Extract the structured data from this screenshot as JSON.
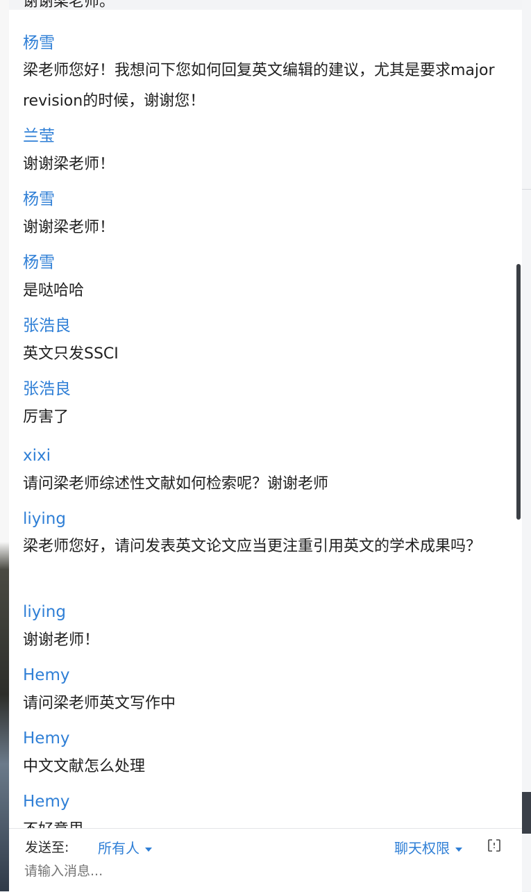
{
  "messages": [
    {
      "sender": "",
      "text": "谢谢梁老师。"
    },
    {
      "sender": "杨雪",
      "text": "梁老师您好！我想问下您如何回复英文编辑的建议，尤其是要求major revision的时候，谢谢您！"
    },
    {
      "sender": "兰莹",
      "text": "谢谢梁老师！"
    },
    {
      "sender": "杨雪",
      "text": "谢谢梁老师！"
    },
    {
      "sender": "杨雪",
      "text": "是哒哈哈"
    },
    {
      "sender": "张浩良",
      "text": "英文只发SSCI"
    },
    {
      "sender": "张浩良",
      "text": "厉害了"
    },
    {
      "sender": "xixi",
      "text": "请问梁老师综述性文献如何检索呢？谢谢老师"
    },
    {
      "sender": "liying",
      "text": "梁老师您好，请问发表英文论文应当更注重引用英文的学术成果吗？"
    },
    {
      "sender": "liying",
      "text": "谢谢老师！"
    },
    {
      "sender": "Hemy",
      "text": "请问梁老师英文写作中"
    },
    {
      "sender": "Hemy",
      "text": "中文文献怎么处理"
    },
    {
      "sender": "Hemy",
      "text": "不好意思"
    }
  ],
  "footer": {
    "send_to_label": "发送至:",
    "recipient": "所有人",
    "permission_label": "聊天权限",
    "input_placeholder": "请输入消息..."
  },
  "icons": {
    "recipient_caret": "caret-down-icon",
    "permission_caret": "caret-down-icon",
    "fullscreen": "fullscreen-icon"
  },
  "colors": {
    "sender": "#2f7fd6",
    "text": "#1f1f1f",
    "placeholder": "#c7c9cc"
  }
}
